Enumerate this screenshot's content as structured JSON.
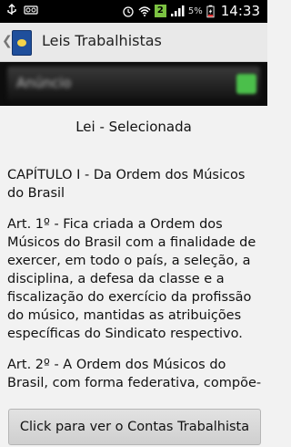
{
  "status_bar": {
    "badge": "2",
    "battery_percent": "5%",
    "time": "14:33"
  },
  "action_bar": {
    "title": "Leis Trabalhistas"
  },
  "ad_banner": {
    "text": "Anúncio"
  },
  "main": {
    "heading": "Lei - Selecionada",
    "paragraphs": [
      "CAPÍTULO I - Da Ordem dos Músicos do Brasil",
      "Art. 1º - Fica criada a Ordem dos Músicos do Brasil com a finalidade de exercer, em todo o país, a seleção, a disciplina, a defesa da classe e a fiscalização do exercício da profissão do músico, mantidas as atribuições específicas do Sindicato respectivo.",
      "Art. 2º - A Ordem dos Músicos do Brasil, com forma federativa, compõe-"
    ]
  },
  "bottom_button": {
    "label": "Click para ver o Contas Trabalhista"
  }
}
